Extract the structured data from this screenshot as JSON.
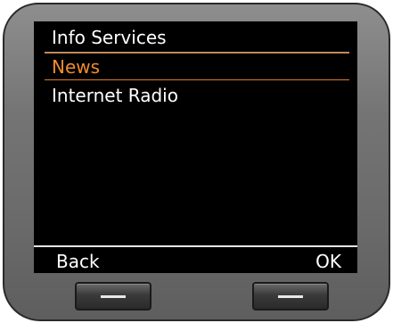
{
  "screen": {
    "title": "Info Services",
    "menu": [
      {
        "label": "News",
        "selected": true
      },
      {
        "label": "Internet Radio",
        "selected": false
      }
    ],
    "softkeys": {
      "left": "Back",
      "right": "OK"
    }
  },
  "colors": {
    "background": "#000000",
    "text": "#ffffff",
    "highlight": "#f08c2c",
    "bezel": "#7a7a7a"
  },
  "hardware_keys": [
    {
      "icon": "dash-icon"
    },
    {
      "icon": "dash-icon"
    }
  ]
}
